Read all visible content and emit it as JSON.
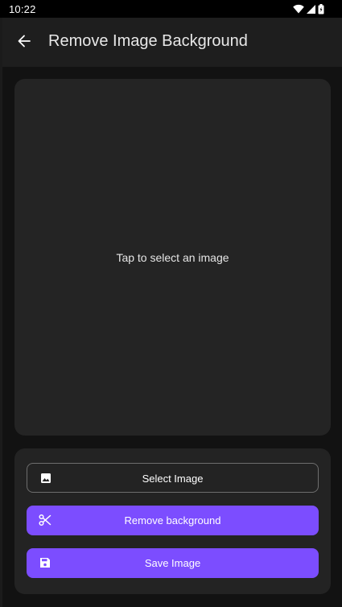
{
  "status_bar": {
    "time": "10:22",
    "icons": [
      "wifi-icon",
      "signal-icon",
      "battery-icon"
    ]
  },
  "app_bar": {
    "back_icon": "arrow-back-icon",
    "title": "Remove Image Background"
  },
  "image_area": {
    "hint": "Tap to select an image"
  },
  "actions": {
    "select_image": {
      "label": "Select Image",
      "icon": "image-icon"
    },
    "remove_background": {
      "label": "Remove background",
      "icon": "scissors-icon"
    },
    "save_image": {
      "label": "Save Image",
      "icon": "save-icon"
    }
  },
  "colors": {
    "accent": "#7c4dff",
    "background": "#121212",
    "surface": "#242424",
    "app_bar": "#1e1e1e"
  }
}
